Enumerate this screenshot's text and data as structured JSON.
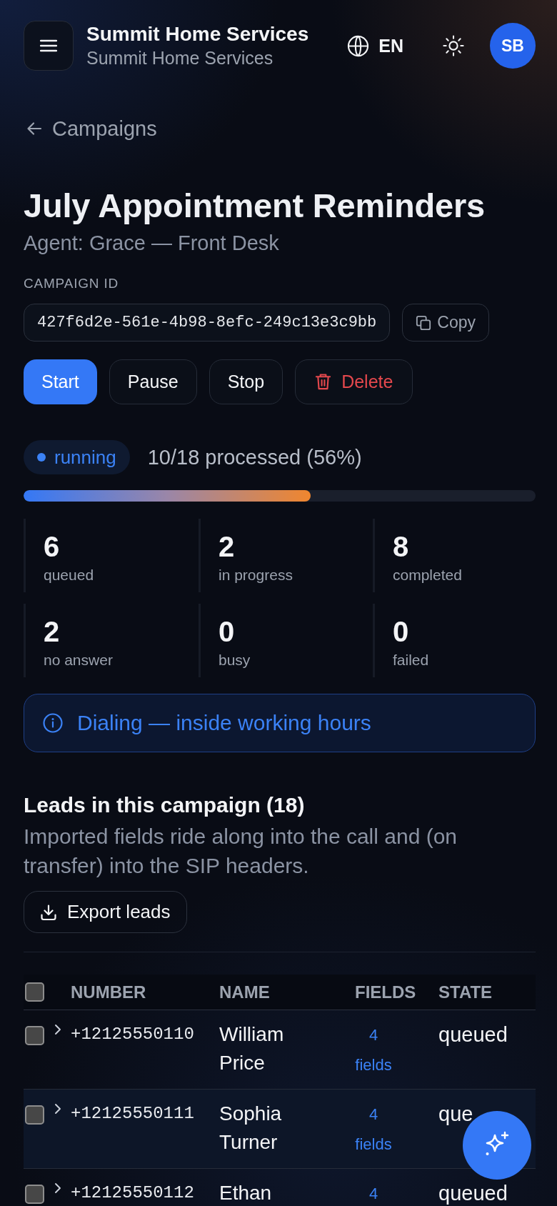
{
  "header": {
    "brand_title": "Summit Home Services",
    "brand_subtitle": "Summit Home Services",
    "language": "EN",
    "avatar_initials": "SB"
  },
  "back_link": {
    "label": "Campaigns"
  },
  "campaign": {
    "title": "July Appointment Reminders",
    "agent": "Agent: Grace — Front Desk",
    "id_label": "CAMPAIGN ID",
    "id_value": "427f6d2e-561e-4b98-8efc-249c13e3c9bb",
    "copy_label": "Copy"
  },
  "actions": [
    {
      "label": "Start",
      "kind": "primary"
    },
    {
      "label": "Pause",
      "kind": "default"
    },
    {
      "label": "Stop",
      "kind": "default"
    },
    {
      "label": "Delete",
      "kind": "danger"
    }
  ],
  "status": {
    "label": "running",
    "progress_text": "10/18 processed (56%)",
    "level": 0.56
  },
  "stats": [
    {
      "value": "6",
      "label": "queued"
    },
    {
      "value": "2",
      "label": "in progress"
    },
    {
      "value": "8",
      "label": "completed"
    },
    {
      "value": "2",
      "label": "no answer"
    },
    {
      "value": "0",
      "label": "busy"
    },
    {
      "value": "0",
      "label": "failed"
    }
  ],
  "notice": {
    "text": "Dialing — inside working hours"
  },
  "leads": {
    "title": "Leads in this campaign (18)",
    "description": "Imported fields ride along into the call and (on transfer) into the SIP headers.",
    "export_label": "Export leads"
  },
  "table": {
    "columns": [
      "NUMBER",
      "NAME",
      "FIELDS",
      "STATE"
    ],
    "all_checked": false,
    "rows": [
      {
        "checked": false,
        "expanded": false,
        "number": "+12125550110",
        "name": "William Price",
        "fields": "4 fields",
        "state": "queued"
      },
      {
        "checked": false,
        "expanded": false,
        "number": "+12125550111",
        "name": "Sophia Turner",
        "fields": "4 fields",
        "state": "que"
      },
      {
        "checked": false,
        "expanded": false,
        "number": "+12125550112",
        "name": "Ethan",
        "fields": "4",
        "state": "queued"
      }
    ]
  }
}
